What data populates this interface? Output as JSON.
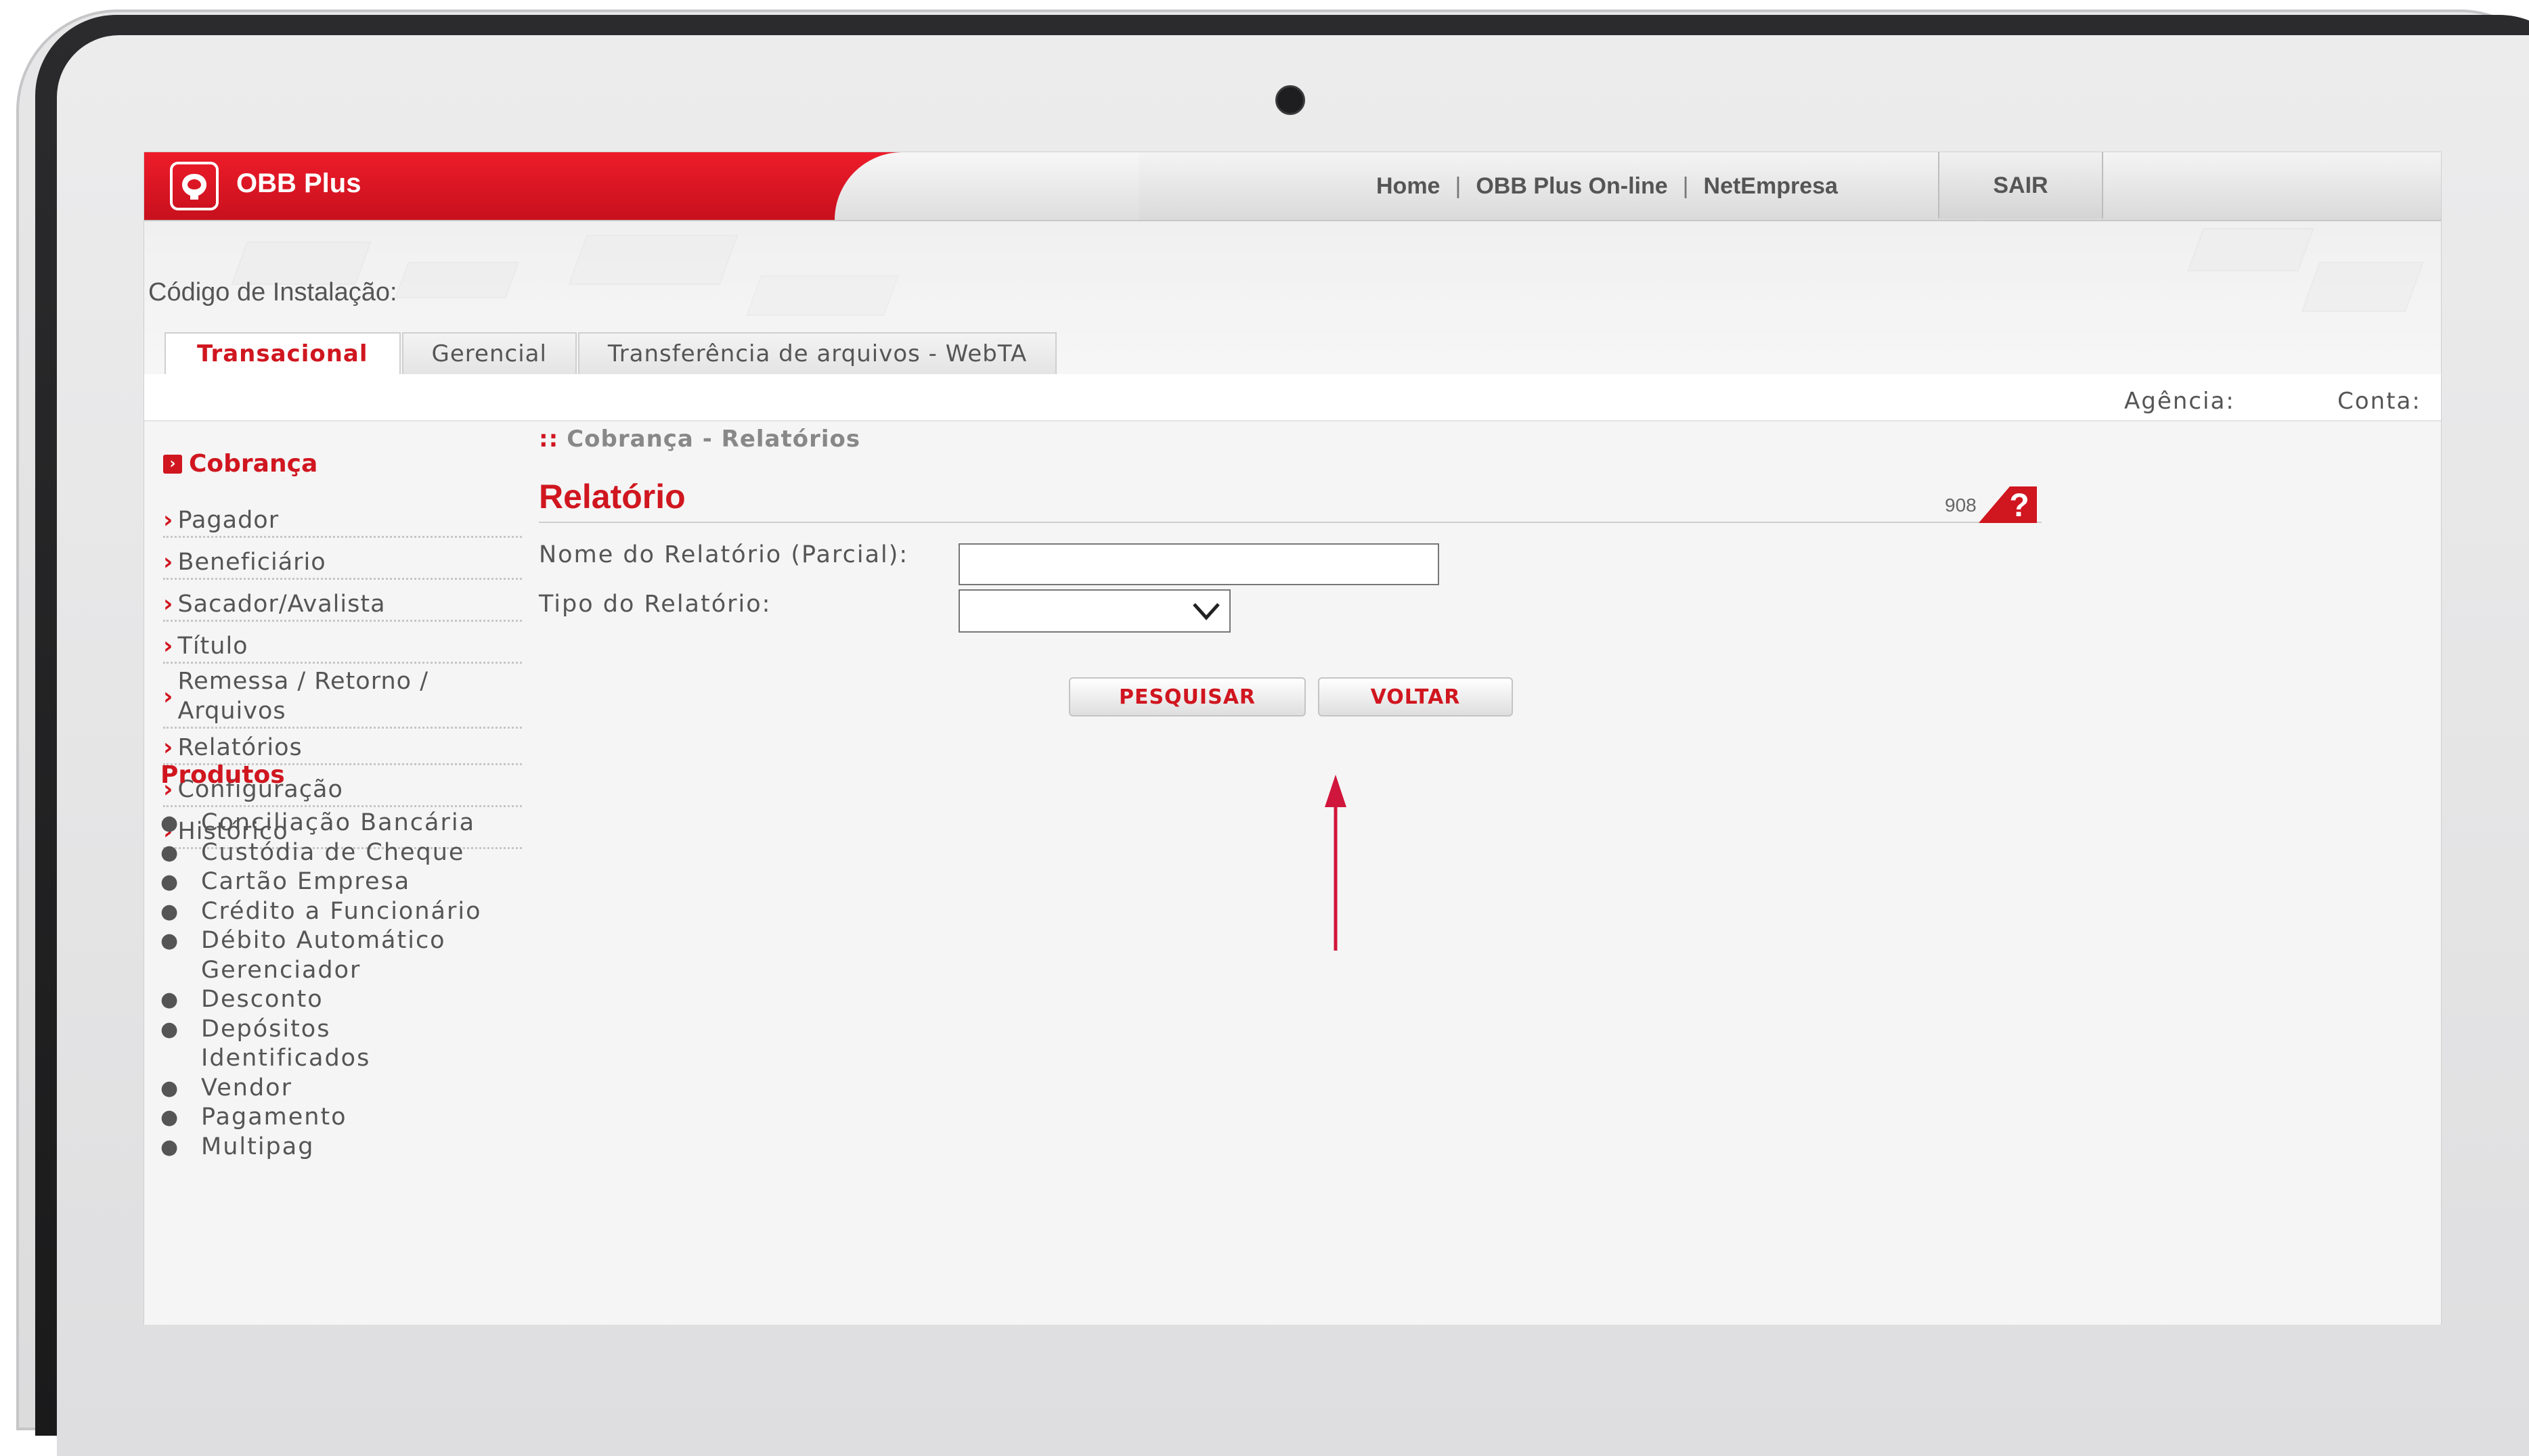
{
  "app": {
    "brand": "OBB Plus"
  },
  "topnav": {
    "home": "Home",
    "online": "OBB Plus On-line",
    "netempresa": "NetEmpresa",
    "separator": "|",
    "logout": "SAIR"
  },
  "header": {
    "install_label": "Código de Instalação:",
    "agencia": "Agência:",
    "conta": "Conta:"
  },
  "tabs": [
    {
      "label": "Transacional",
      "active": true
    },
    {
      "label": "Gerencial",
      "active": false
    },
    {
      "label": "Transferência de arquivos - WebTA",
      "active": false
    }
  ],
  "sidebar": {
    "section": "Cobrança",
    "items": [
      {
        "label": "Pagador"
      },
      {
        "label": "Beneficiário"
      },
      {
        "label": "Sacador/Avalista"
      },
      {
        "label": "Título"
      },
      {
        "label_line1": "Remessa / Retorno /",
        "label_line2": "Arquivos"
      },
      {
        "label": "Relatórios"
      },
      {
        "label": "Configuração"
      },
      {
        "label": "Histórico"
      }
    ],
    "products_heading": "Produtos",
    "products": [
      "Conciliação Bancária",
      "Custódia de Cheque",
      "Cartão Empresa",
      "Crédito a Funcionário",
      "Débito Automático",
      "Gerenciador",
      "Desconto",
      "Depósitos",
      "Identificados",
      "Vendor",
      "Pagamento",
      "Multipag"
    ]
  },
  "main": {
    "breadcrumb_marker": "::",
    "breadcrumb": "Cobrança - Relatórios",
    "title": "Relatório",
    "help_code": "908",
    "form": {
      "name_label": "Nome do Relatório (Parcial):",
      "name_value": "",
      "type_label": "Tipo do Relatório:",
      "type_value": ""
    },
    "buttons": {
      "search": "PESQUISAR",
      "back": "VOLTAR"
    }
  },
  "colors": {
    "brand_red": "#d0161f",
    "text_gray": "#555555",
    "annotation_arrow": "#d0163c"
  }
}
